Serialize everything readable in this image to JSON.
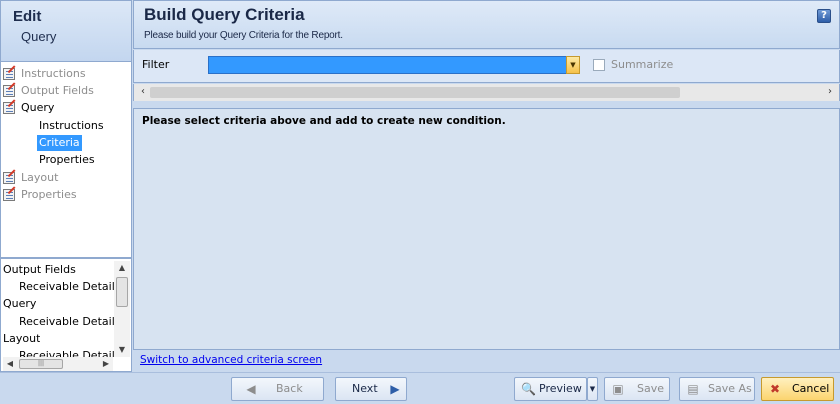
{
  "edit_panel": {
    "title": "Edit",
    "subtitle": "Query"
  },
  "nav_tree": [
    {
      "label": "Instructions",
      "state": "disabled",
      "icon": "checklist-icon"
    },
    {
      "label": "Output Fields",
      "state": "disabled",
      "icon": "checklist-icon"
    },
    {
      "label": "Query",
      "state": "enabled",
      "icon": "checklist-icon"
    },
    {
      "label": "Instructions",
      "state": "enabled"
    },
    {
      "label": "Criteria",
      "state": "selected"
    },
    {
      "label": "Properties",
      "state": "enabled"
    },
    {
      "label": "Layout",
      "state": "disabled",
      "icon": "checklist-icon"
    },
    {
      "label": "Properties",
      "state": "disabled",
      "icon": "checklist-icon"
    }
  ],
  "detail_list": [
    "Output Fields",
    "Receivable Details",
    "Query",
    "Receivable Details",
    "Layout",
    "Receivable Details"
  ],
  "header": {
    "title": "Build Query Criteria",
    "subtitle": "Please build your Query Criteria for the Report.",
    "help_icon": "?"
  },
  "filter": {
    "label": "Filter",
    "value": "",
    "summarize_label": "Summarize",
    "summarize_checked": false
  },
  "criteria": {
    "message": "Please select criteria above and add to create new condition."
  },
  "advanced_link": "Switch to advanced criteria screen",
  "toolbar": {
    "back": "Back",
    "next": "Next",
    "preview": "Preview",
    "save": "Save",
    "save_as": "Save As",
    "cancel": "Cancel"
  },
  "colors": {
    "selection": "#3399ff",
    "panel_bg": "#d7e3f1",
    "link": "#0000ee",
    "cancel_button": "#fbd46f"
  }
}
